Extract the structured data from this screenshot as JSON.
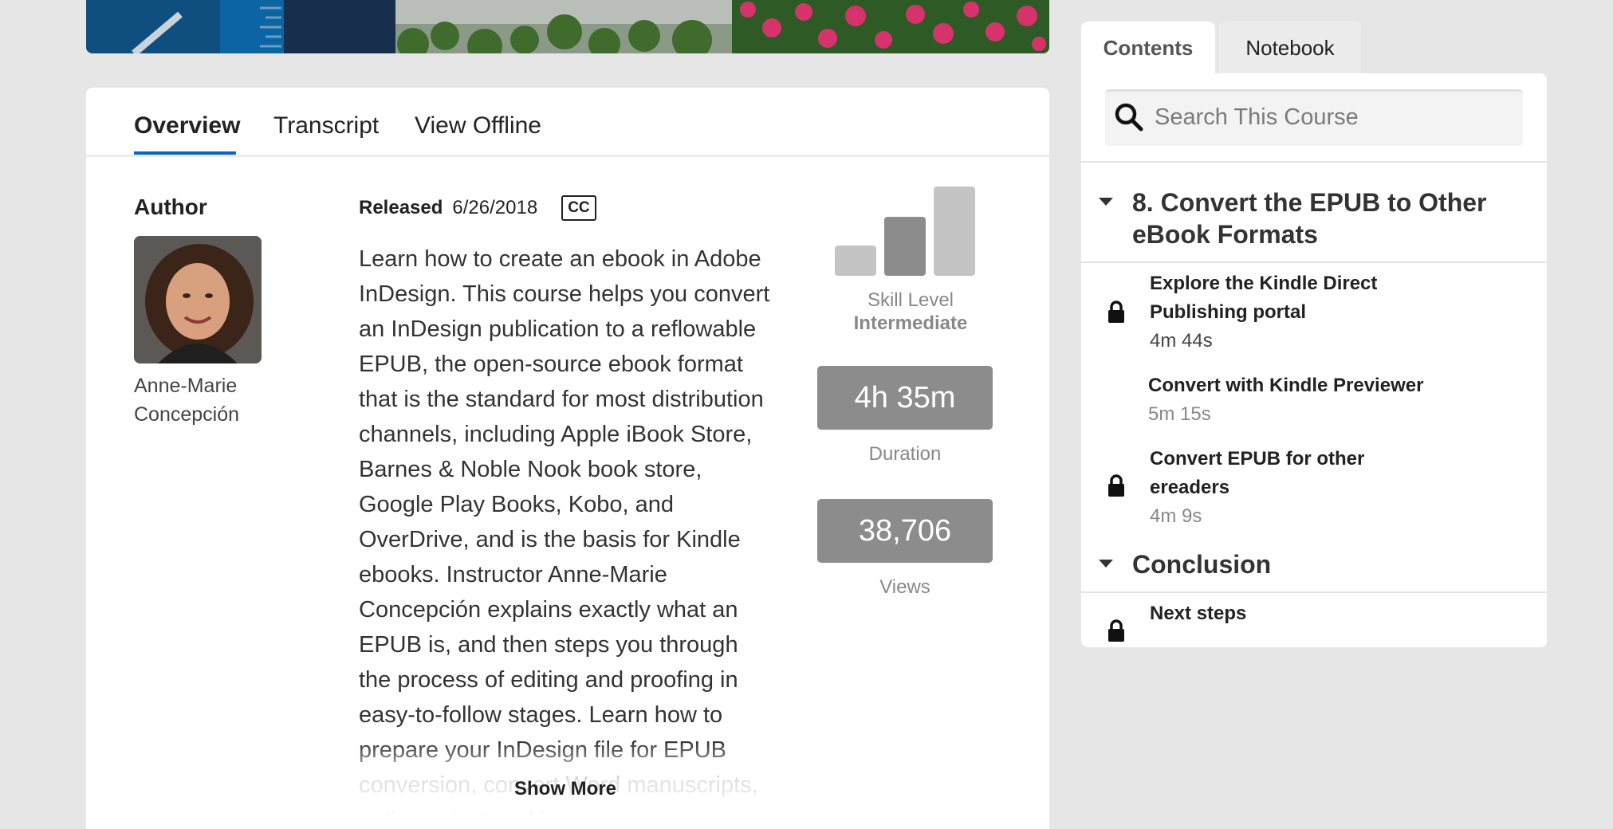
{
  "tabs": [
    {
      "label": "Overview",
      "active": true
    },
    {
      "label": "Transcript",
      "active": false
    },
    {
      "label": "View Offline",
      "active": false
    }
  ],
  "author": {
    "heading": "Author",
    "name": "Anne-Marie Concepción"
  },
  "release": {
    "label": "Released",
    "date": "6/26/2018",
    "cc_badge": "CC"
  },
  "description": "Learn how to create an ebook in Adobe InDesign. This course helps you convert an InDesign publication to a reflowable EPUB, the open-source ebook format that is the standard for most distribution channels, including Apple iBook Store, Barnes & Noble Nook book store, Google Play Books, Kobo, and OverDrive, and is the basis for Kindle ebooks. Instructor Anne-Marie Concepción explains exactly what an EPUB is, and then steps you through the process of editing and proofing in easy-to-follow stages. Learn how to prepare your InDesign file for EPUB conversion, convert Word manuscripts, optimize text and images",
  "show_more": "Show More",
  "skill": {
    "label": "Skill Level",
    "level": "Intermediate",
    "icon": "skill-level-bars-icon"
  },
  "stats": {
    "duration_value": "4h 35m",
    "duration_label": "Duration",
    "views_value": "38,706",
    "views_label": "Views"
  },
  "side_tabs": [
    {
      "label": "Contents",
      "active": true
    },
    {
      "label": "Notebook",
      "active": false
    }
  ],
  "search": {
    "placeholder": "Search This Course"
  },
  "toc": {
    "chapter8": {
      "title": "8. Convert the EPUB to Other eBook Formats",
      "videos": [
        {
          "title": "Explore the Kindle Direct Publishing portal",
          "duration": "4m 44s",
          "locked": true
        },
        {
          "title": "Convert with Kindle Previewer",
          "duration": "5m 15s",
          "locked": false
        },
        {
          "title": "Convert EPUB for other ereaders",
          "duration": "4m 9s",
          "locked": true
        }
      ]
    },
    "conclusion": {
      "title": "Conclusion",
      "videos": [
        {
          "title": "Next steps",
          "locked": true
        }
      ]
    }
  },
  "colors": {
    "accent": "#0a66c2",
    "stat_box": "#8c8c8c",
    "page_bg": "#e6e6e6"
  }
}
